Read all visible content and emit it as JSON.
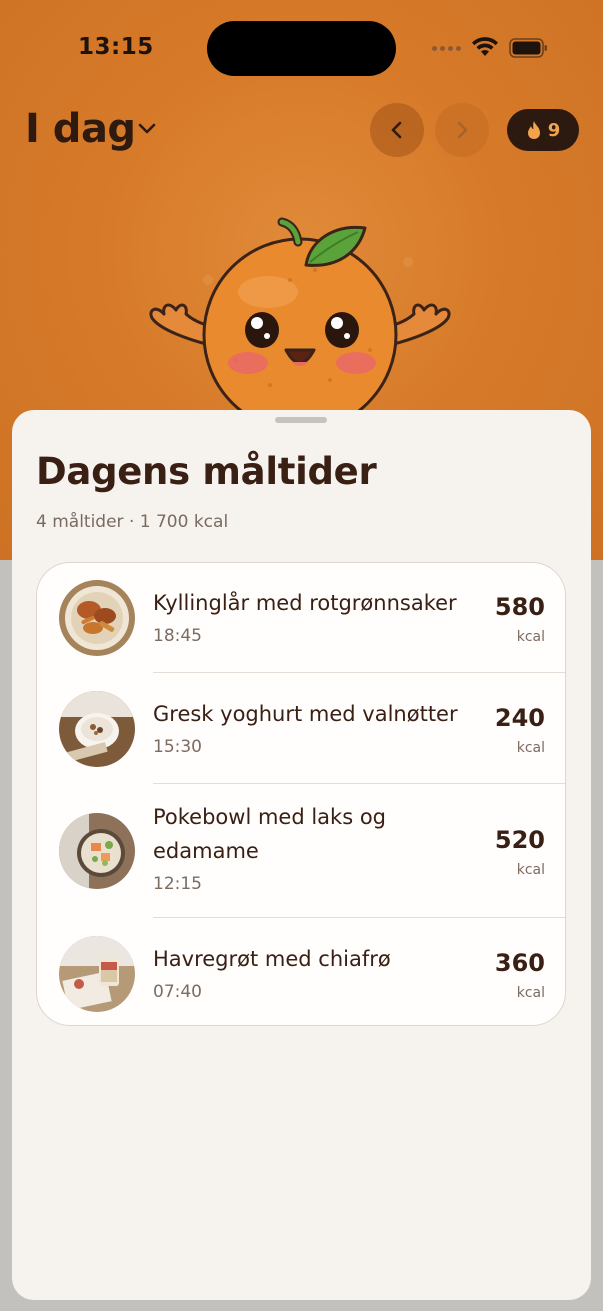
{
  "status_bar": {
    "time": "13:15"
  },
  "header": {
    "title": "I dag",
    "streak_count": "9"
  },
  "sheet": {
    "title": "Dagens måltider",
    "subtitle": "4 måltider · 1 700 kcal"
  },
  "meals": [
    {
      "name": "Kyllinglår med rotgrønnsaker",
      "time": "18:45",
      "kcal": "580",
      "unit": "kcal"
    },
    {
      "name": "Gresk yoghurt med valnøtter",
      "time": "15:30",
      "kcal": "240",
      "unit": "kcal"
    },
    {
      "name": "Pokebowl med laks og edamame",
      "time": "12:15",
      "kcal": "520",
      "unit": "kcal"
    },
    {
      "name": "Havregrøt med chiafrø",
      "time": "07:40",
      "kcal": "360",
      "unit": "kcal"
    }
  ],
  "colors": {
    "hero_orange": "#d77b2a",
    "sheet_bg": "#f6f3ee",
    "text_dark": "#3a2014",
    "streak_bg": "#2c1a10",
    "streak_accent": "#f3a24d"
  },
  "icons": [
    "wifi-icon",
    "battery-icon",
    "chevron-down-icon",
    "chevron-left-icon",
    "chevron-right-icon",
    "flame-icon",
    "orange-mascot"
  ]
}
